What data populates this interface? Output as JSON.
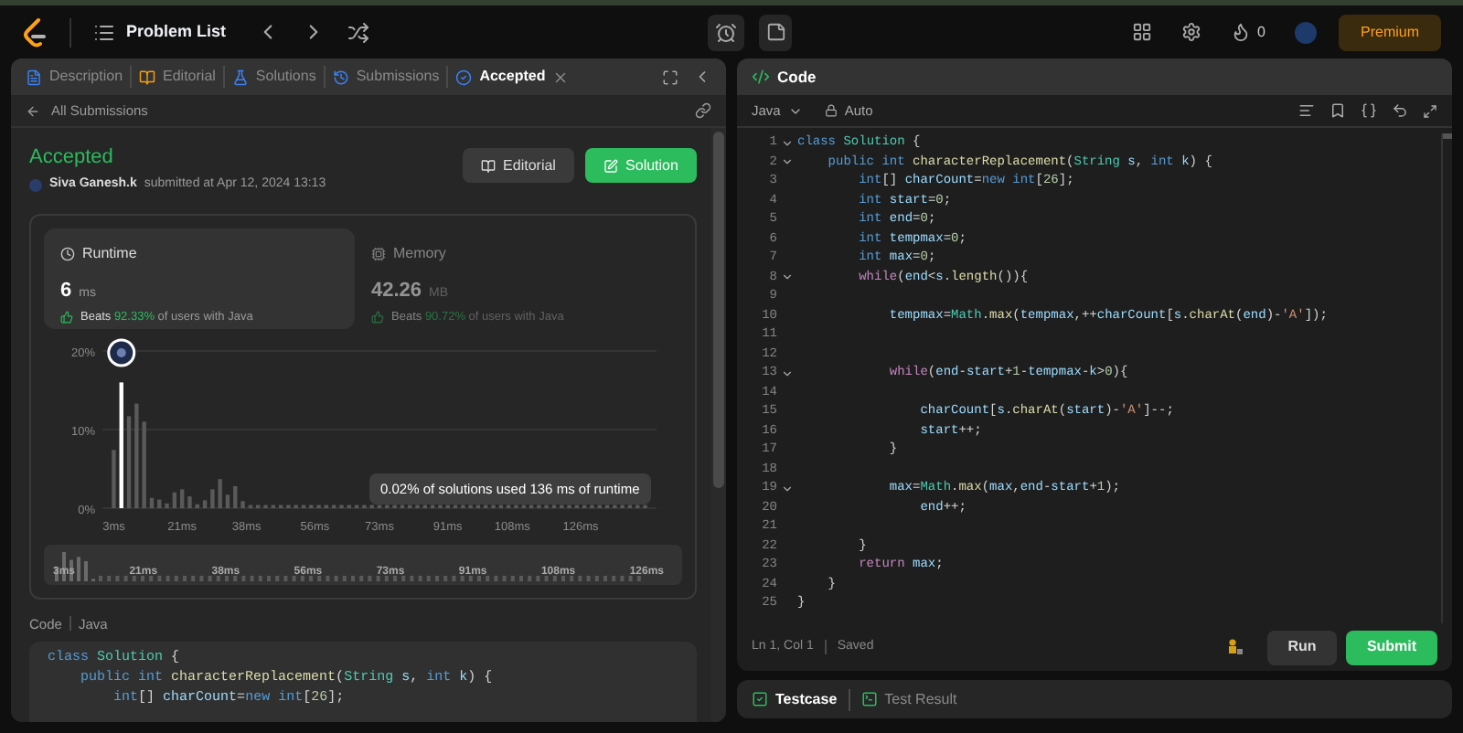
{
  "topbar": {
    "nav_title": "Problem List",
    "streak": "0",
    "premium": "Premium"
  },
  "left_panel": {
    "tabs": [
      {
        "label": "Description",
        "selected": false
      },
      {
        "label": "Editorial",
        "selected": false
      },
      {
        "label": "Solutions",
        "selected": false
      },
      {
        "label": "Submissions",
        "selected": false
      },
      {
        "label": "Accepted",
        "selected": true
      }
    ],
    "back_link": "All Submissions",
    "submission": {
      "status": "Accepted",
      "author": "Siva Ganesh.k",
      "submitted": "submitted at Apr 12, 2024 13:13"
    },
    "buttons": [
      {
        "label": "Editorial",
        "kind": "secondary"
      },
      {
        "label": "Solution",
        "kind": "primary"
      }
    ],
    "stats": [
      {
        "label": "Runtime",
        "value": "6",
        "unit": "ms",
        "beats": "Beats",
        "percent": "92.33%",
        "suffix": "of users with Java",
        "selected": true
      },
      {
        "label": "Memory",
        "value": "42.26",
        "unit": "MB",
        "beats": "Beats",
        "percent": "90.72%",
        "suffix": "of users with Java",
        "selected": false
      }
    ],
    "chart_data": {
      "type": "bar",
      "stacked": true,
      "x": [
        3,
        5,
        7,
        9,
        11,
        13,
        15,
        17,
        19,
        21,
        23,
        25,
        27,
        29,
        31,
        33,
        35,
        37,
        39,
        41,
        43,
        45,
        47,
        49,
        51,
        53,
        55,
        57,
        59,
        61,
        63,
        65,
        67,
        69,
        71,
        73,
        75,
        77,
        79,
        81,
        83,
        85,
        87,
        89,
        91,
        93,
        95,
        97,
        99,
        101,
        103,
        105,
        107,
        109,
        111,
        113,
        115,
        117,
        119,
        121,
        123,
        125,
        127,
        129,
        131,
        133,
        135,
        137,
        139,
        141,
        143
      ],
      "series": [
        {
          "color": "#5a5a5a",
          "values": [
            7.4,
            null,
            11.7,
            13.3,
            11,
            1.3,
            1.1,
            0.6,
            2,
            2.4,
            1.5,
            0.5,
            1,
            2.4,
            3.7,
            1.7,
            2.8,
            0.9,
            0.4,
            0.4,
            0.4,
            0.4,
            0.4,
            0.4,
            0.4,
            0.4,
            0.4,
            0.4,
            0.4,
            0.4,
            0.4,
            0.4,
            0.4,
            0.4,
            0.4,
            0.4,
            0.4,
            0.4,
            0.4,
            0.4,
            0.4,
            0.4,
            0.4,
            0.4,
            0.4,
            0.4,
            0.4,
            0.4,
            0.4,
            0.4,
            0.4,
            0.4,
            0.4,
            0.4,
            0.4,
            0.4,
            0.4,
            0.4,
            0.4,
            0.4,
            0.4,
            0.4,
            0.4,
            0.4,
            0.4,
            0.4,
            0.4,
            0.4,
            0.4,
            0.4,
            0.4
          ]
        },
        {
          "color": "#ffffff",
          "values": [
            null,
            16,
            null,
            null,
            null,
            null,
            null,
            null,
            null,
            null,
            null,
            null,
            null,
            null,
            null,
            null,
            null,
            null,
            null,
            null,
            null,
            null,
            null,
            null,
            null,
            null,
            null,
            null,
            null,
            null,
            null,
            null,
            null,
            null,
            null,
            null,
            null,
            null,
            null,
            null,
            null,
            null,
            null,
            null,
            null,
            null,
            null,
            null,
            null,
            null,
            null,
            null,
            null,
            null,
            null,
            null,
            null,
            null,
            null,
            null,
            null,
            null,
            null,
            null,
            null,
            null,
            null,
            null,
            null,
            null,
            null
          ]
        }
      ],
      "xlim": [
        0,
        146
      ],
      "ylim": [
        0,
        20
      ],
      "yticks": [
        {
          "value": 0,
          "label": "0%"
        },
        {
          "value": 10,
          "label": "10%"
        },
        {
          "value": 20,
          "label": "20%"
        }
      ],
      "xticks": [
        {
          "value": 3,
          "label": "3ms"
        },
        {
          "value": 21,
          "label": "21ms"
        },
        {
          "value": 38,
          "label": "38ms"
        },
        {
          "value": 56,
          "label": "56ms"
        },
        {
          "value": 73,
          "label": "73ms"
        },
        {
          "value": 91,
          "label": "91ms"
        },
        {
          "value": 108,
          "label": "108ms"
        },
        {
          "value": 126,
          "label": "126ms"
        }
      ]
    },
    "tooltip": "0.02% of solutions used 136 ms of runtime",
    "overview_labels": [
      "3ms",
      "21ms",
      "38ms",
      "56ms",
      "73ms",
      "91ms",
      "108ms",
      "126ms"
    ],
    "code_section": {
      "label": "Code",
      "language": "Java",
      "lines": [
        [
          {
            "kind": "kw",
            "text": "class"
          },
          {
            "kind": "type",
            "text": " Solution"
          },
          {
            "kind": "p",
            "text": " {"
          }
        ],
        [
          {
            "kind": "kw",
            "text": "    public"
          },
          {
            "kind": "kw",
            "text": " int"
          },
          {
            "kind": "fn",
            "text": " characterReplacement"
          },
          {
            "kind": "p",
            "text": "("
          },
          {
            "kind": "type",
            "text": "String"
          },
          {
            "kind": "var",
            "text": " s"
          },
          {
            "kind": "p",
            "text": ", "
          },
          {
            "kind": "kw",
            "text": "int"
          },
          {
            "kind": "var",
            "text": " k"
          },
          {
            "kind": "p",
            "text": ") {"
          }
        ],
        [
          {
            "kind": "kw",
            "text": "        int"
          },
          {
            "kind": "p",
            "text": "[] "
          },
          {
            "kind": "var",
            "text": "charCount"
          },
          {
            "kind": "p",
            "text": "="
          },
          {
            "kind": "kw",
            "text": "new"
          },
          {
            "kind": "kw",
            "text": " int"
          },
          {
            "kind": "p",
            "text": "["
          },
          {
            "kind": "num",
            "text": "26"
          },
          {
            "kind": "p",
            "text": "];"
          }
        ]
      ]
    }
  },
  "editor": {
    "title": "Code",
    "language": "Java",
    "mode": "Auto",
    "lines": [
      {
        "n": "1",
        "fold": true,
        "tokens": [
          {
            "kind": "kw",
            "text": "class"
          },
          {
            "kind": "type",
            "text": " Solution"
          },
          {
            "kind": "p",
            "text": " {"
          }
        ]
      },
      {
        "n": "2",
        "fold": true,
        "tokens": [
          {
            "kind": "kw",
            "text": "    public"
          },
          {
            "kind": "kw",
            "text": " int"
          },
          {
            "kind": "fn",
            "text": " characterReplacement"
          },
          {
            "kind": "p",
            "text": "("
          },
          {
            "kind": "type",
            "text": "String"
          },
          {
            "kind": "var",
            "text": " s"
          },
          {
            "kind": "p",
            "text": ", "
          },
          {
            "kind": "kw",
            "text": "int"
          },
          {
            "kind": "var",
            "text": " k"
          },
          {
            "kind": "p",
            "text": ") {"
          }
        ]
      },
      {
        "n": "3",
        "fold": false,
        "tokens": [
          {
            "kind": "kw",
            "text": "        int"
          },
          {
            "kind": "p",
            "text": "[] "
          },
          {
            "kind": "var",
            "text": "charCount"
          },
          {
            "kind": "p",
            "text": "="
          },
          {
            "kind": "kw",
            "text": "new"
          },
          {
            "kind": "kw",
            "text": " int"
          },
          {
            "kind": "p",
            "text": "["
          },
          {
            "kind": "num",
            "text": "26"
          },
          {
            "kind": "p",
            "text": "];"
          }
        ]
      },
      {
        "n": "4",
        "fold": false,
        "tokens": [
          {
            "kind": "kw",
            "text": "        int"
          },
          {
            "kind": "var",
            "text": " start"
          },
          {
            "kind": "p",
            "text": "="
          },
          {
            "kind": "num",
            "text": "0"
          },
          {
            "kind": "p",
            "text": ";"
          }
        ]
      },
      {
        "n": "5",
        "fold": false,
        "tokens": [
          {
            "kind": "kw",
            "text": "        int"
          },
          {
            "kind": "var",
            "text": " end"
          },
          {
            "kind": "p",
            "text": "="
          },
          {
            "kind": "num",
            "text": "0"
          },
          {
            "kind": "p",
            "text": ";"
          }
        ]
      },
      {
        "n": "6",
        "fold": false,
        "tokens": [
          {
            "kind": "kw",
            "text": "        int"
          },
          {
            "kind": "var",
            "text": " tempmax"
          },
          {
            "kind": "p",
            "text": "="
          },
          {
            "kind": "num",
            "text": "0"
          },
          {
            "kind": "p",
            "text": ";"
          }
        ]
      },
      {
        "n": "7",
        "fold": false,
        "tokens": [
          {
            "kind": "kw",
            "text": "        int"
          },
          {
            "kind": "var",
            "text": " max"
          },
          {
            "kind": "p",
            "text": "="
          },
          {
            "kind": "num",
            "text": "0"
          },
          {
            "kind": "p",
            "text": ";"
          }
        ]
      },
      {
        "n": "8",
        "fold": true,
        "tokens": [
          {
            "kind": "ctl",
            "text": "        while"
          },
          {
            "kind": "p",
            "text": "("
          },
          {
            "kind": "var",
            "text": "end"
          },
          {
            "kind": "p",
            "text": "<"
          },
          {
            "kind": "var",
            "text": "s"
          },
          {
            "kind": "p",
            "text": "."
          },
          {
            "kind": "fn",
            "text": "length"
          },
          {
            "kind": "p",
            "text": "()){"
          }
        ]
      },
      {
        "n": "9",
        "fold": false
      },
      {
        "n": "10",
        "fold": false,
        "tokens": [
          {
            "kind": "var",
            "text": "            tempmax"
          },
          {
            "kind": "p",
            "text": "="
          },
          {
            "kind": "type",
            "text": "Math"
          },
          {
            "kind": "p",
            "text": "."
          },
          {
            "kind": "fn",
            "text": "max"
          },
          {
            "kind": "p",
            "text": "("
          },
          {
            "kind": "var",
            "text": "tempmax"
          },
          {
            "kind": "p",
            "text": ",++"
          },
          {
            "kind": "var",
            "text": "charCount"
          },
          {
            "kind": "p",
            "text": "["
          },
          {
            "kind": "var",
            "text": "s"
          },
          {
            "kind": "p",
            "text": "."
          },
          {
            "kind": "fn",
            "text": "charAt"
          },
          {
            "kind": "p",
            "text": "("
          },
          {
            "kind": "var",
            "text": "end"
          },
          {
            "kind": "p",
            "text": ")-"
          },
          {
            "kind": "str",
            "text": "'A'"
          },
          {
            "kind": "p",
            "text": "]);"
          }
        ]
      },
      {
        "n": "11",
        "fold": false
      },
      {
        "n": "12",
        "fold": false
      },
      {
        "n": "13",
        "fold": true,
        "tokens": [
          {
            "kind": "ctl",
            "text": "            while"
          },
          {
            "kind": "p",
            "text": "("
          },
          {
            "kind": "var",
            "text": "end"
          },
          {
            "kind": "p",
            "text": "-"
          },
          {
            "kind": "var",
            "text": "start"
          },
          {
            "kind": "p",
            "text": "+"
          },
          {
            "kind": "num",
            "text": "1"
          },
          {
            "kind": "p",
            "text": "-"
          },
          {
            "kind": "var",
            "text": "tempmax"
          },
          {
            "kind": "p",
            "text": "-"
          },
          {
            "kind": "var",
            "text": "k"
          },
          {
            "kind": "p",
            "text": ">"
          },
          {
            "kind": "num",
            "text": "0"
          },
          {
            "kind": "p",
            "text": "){"
          }
        ]
      },
      {
        "n": "14",
        "fold": false
      },
      {
        "n": "15",
        "fold": false,
        "tokens": [
          {
            "kind": "var",
            "text": "                charCount"
          },
          {
            "kind": "p",
            "text": "["
          },
          {
            "kind": "var",
            "text": "s"
          },
          {
            "kind": "p",
            "text": "."
          },
          {
            "kind": "fn",
            "text": "charAt"
          },
          {
            "kind": "p",
            "text": "("
          },
          {
            "kind": "var",
            "text": "start"
          },
          {
            "kind": "p",
            "text": ")-"
          },
          {
            "kind": "str",
            "text": "'A'"
          },
          {
            "kind": "p",
            "text": "]--;"
          }
        ]
      },
      {
        "n": "16",
        "fold": false,
        "tokens": [
          {
            "kind": "var",
            "text": "                start"
          },
          {
            "kind": "p",
            "text": "++;"
          }
        ]
      },
      {
        "n": "17",
        "fold": false,
        "tokens": [
          {
            "kind": "p",
            "text": "            }"
          }
        ]
      },
      {
        "n": "18",
        "fold": false
      },
      {
        "n": "19",
        "fold": true,
        "tokens": [
          {
            "kind": "var",
            "text": "            max"
          },
          {
            "kind": "p",
            "text": "="
          },
          {
            "kind": "type",
            "text": "Math"
          },
          {
            "kind": "p",
            "text": "."
          },
          {
            "kind": "fn",
            "text": "max"
          },
          {
            "kind": "p",
            "text": "("
          },
          {
            "kind": "var",
            "text": "max"
          },
          {
            "kind": "p",
            "text": ","
          },
          {
            "kind": "var",
            "text": "end"
          },
          {
            "kind": "p",
            "text": "-"
          },
          {
            "kind": "var",
            "text": "start"
          },
          {
            "kind": "p",
            "text": "+"
          },
          {
            "kind": "num",
            "text": "1"
          },
          {
            "kind": "p",
            "text": ");"
          }
        ]
      },
      {
        "n": "20",
        "fold": false,
        "tokens": [
          {
            "kind": "var",
            "text": "                end"
          },
          {
            "kind": "p",
            "text": "++;"
          }
        ]
      },
      {
        "n": "21",
        "fold": false
      },
      {
        "n": "22",
        "fold": false,
        "tokens": [
          {
            "kind": "p",
            "text": "        }"
          }
        ]
      },
      {
        "n": "23",
        "fold": false,
        "tokens": [
          {
            "kind": "ctl",
            "text": "        return"
          },
          {
            "kind": "var",
            "text": " max"
          },
          {
            "kind": "p",
            "text": ";"
          }
        ]
      },
      {
        "n": "24",
        "fold": false,
        "tokens": [
          {
            "kind": "p",
            "text": "    }"
          }
        ]
      },
      {
        "n": "25",
        "fold": false,
        "tokens": [
          {
            "kind": "p",
            "text": "}"
          }
        ]
      }
    ],
    "cursor": "Ln 1, Col 1",
    "save_state": "Saved",
    "buttons": [
      {
        "label": "Run",
        "kind": "secondary"
      },
      {
        "label": "Submit",
        "kind": "primary"
      }
    ]
  },
  "bottom_tabs": [
    {
      "label": "Testcase",
      "selected": true
    },
    {
      "label": "Test Result",
      "selected": false
    }
  ]
}
